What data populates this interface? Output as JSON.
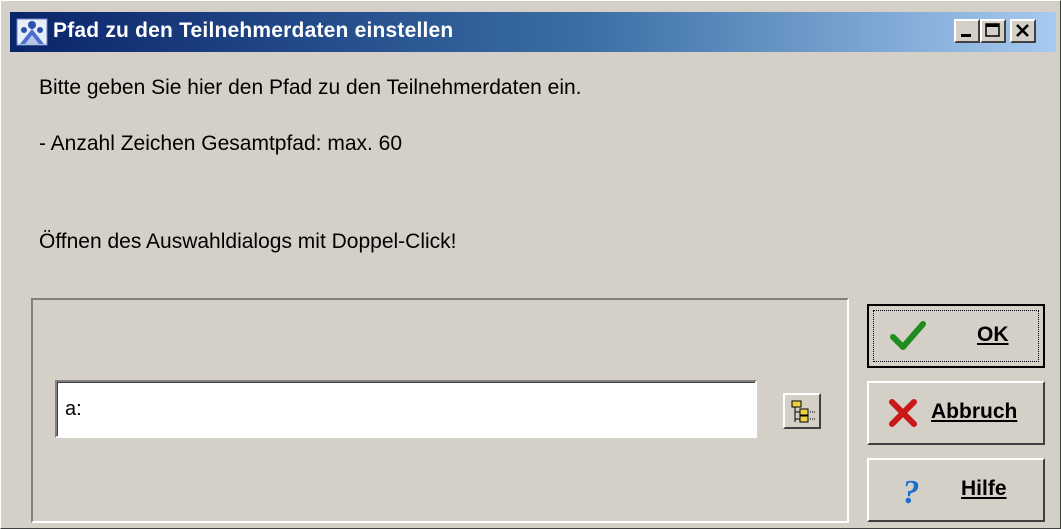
{
  "window": {
    "title": "Pfad zu den Teilnehmerdaten einstellen",
    "titlebar_buttons": [
      "minimize-icon",
      "maximize-icon",
      "close-icon"
    ]
  },
  "messages": {
    "line1": "Bitte geben Sie hier den Pfad zu den Teilnehmerdaten ein.",
    "line2": "- Anzahl Zeichen Gesamtpfad: max. 60",
    "line3": "Öffnen des Auswahldialogs mit Doppel-Click!"
  },
  "path_field": {
    "value": "a:"
  },
  "buttons": {
    "ok": {
      "label": "OK",
      "icon": "checkmark-icon"
    },
    "cancel": {
      "label": "Abbruch",
      "icon": "red-x-icon"
    },
    "help": {
      "label": "Hilfe",
      "icon": "question-mark-icon"
    }
  },
  "colors": {
    "titlebar_start": "#0a246a",
    "titlebar_end": "#a6caf0",
    "dialog_bg": "#d4d0c8"
  }
}
